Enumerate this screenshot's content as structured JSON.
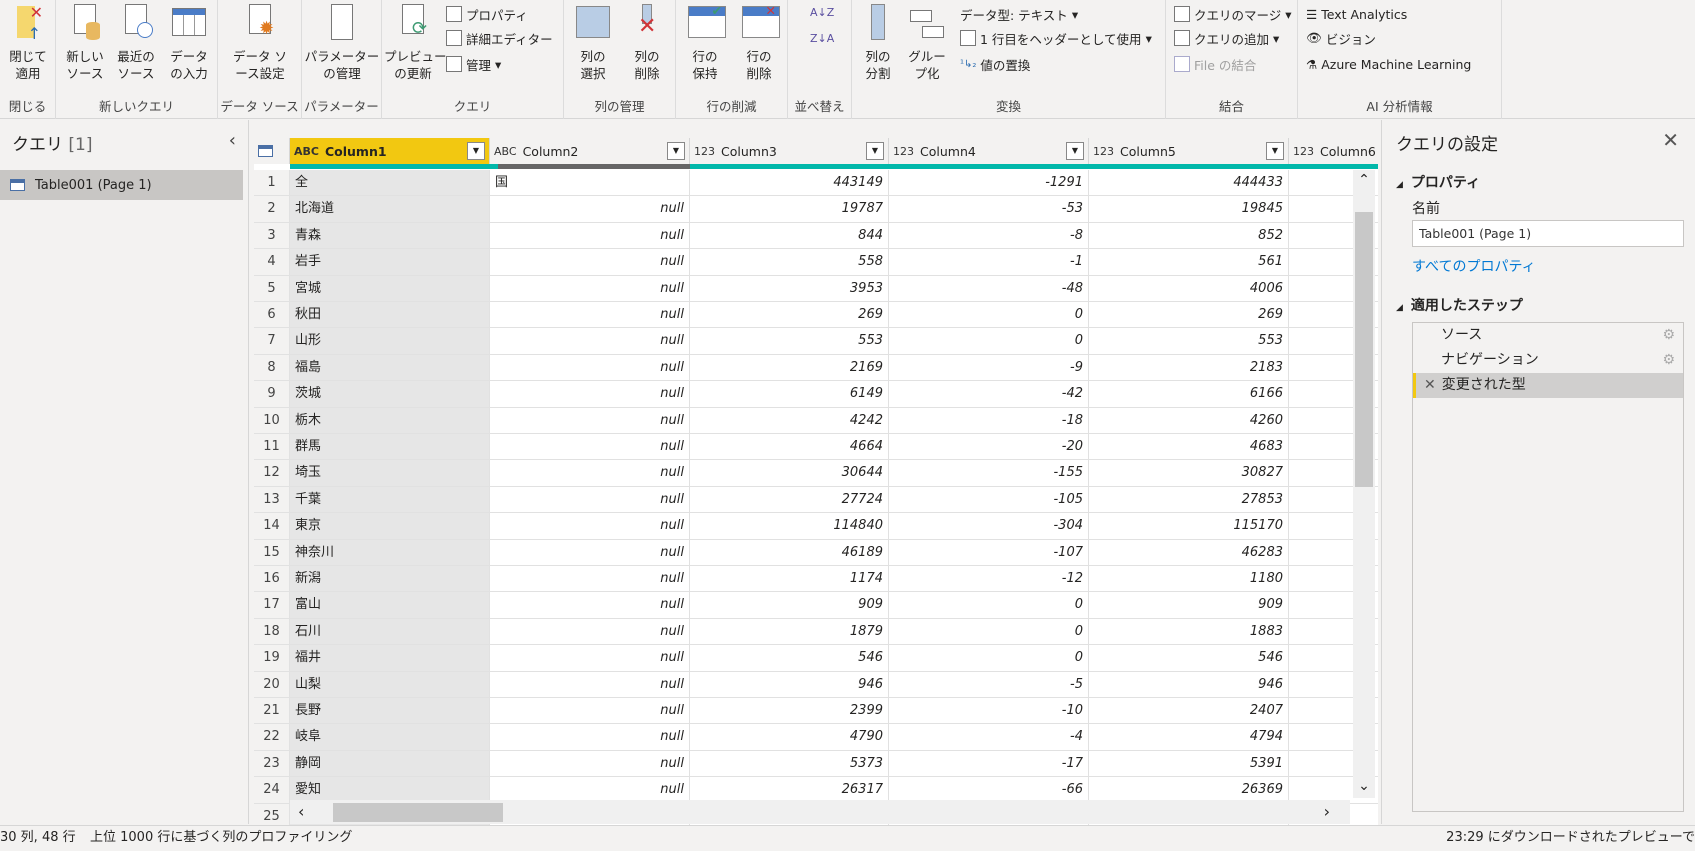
{
  "ribbon": {
    "close": {
      "btn": "閉じて\n適用",
      "label": "閉じる"
    },
    "newquery": {
      "new_source": "新しい\nソース",
      "recent": "最近の\nソース",
      "enter": "データ\nの入力",
      "label": "新しいクエリ"
    },
    "datasource": {
      "settings": "データ ソ\nース設定",
      "label": "データ ソース"
    },
    "params": {
      "manage": "パラメーター\nの管理",
      "label": "パラメーター"
    },
    "query": {
      "refresh": "プレビュー\nの更新",
      "properties": "プロパティ",
      "advanced": "詳細エディター",
      "manage": "管理",
      "label": "クエリ"
    },
    "columns": {
      "choose": "列の\n選択",
      "remove": "列の\n削除",
      "label": "列の管理"
    },
    "rows": {
      "keep": "行の\n保持",
      "remove": "行の\n削除",
      "label": "行の削減"
    },
    "sort": {
      "asc": "A↓Z",
      "desc": "Z↓A",
      "label": "並べ替え"
    },
    "transform": {
      "split": "列の\n分割",
      "group": "グルー\nプ化",
      "datatype": "データ型: テキスト",
      "header": "1 行目をヘッダーとして使用",
      "replace": "値の置換",
      "label": "変換"
    },
    "combine": {
      "merge": "クエリのマージ",
      "append": "クエリの追加",
      "files": "File の結合",
      "label": "結合"
    },
    "ai": {
      "text": "Text Analytics",
      "vision": "ビジョン",
      "azure": "Azure Machine Learning",
      "label": "AI 分析情報"
    }
  },
  "queries": {
    "title": "クエリ",
    "count": "[1]",
    "items": [
      "Table001 (Page 1)"
    ]
  },
  "grid": {
    "columns": [
      {
        "name": "Column1",
        "type": "ABC"
      },
      {
        "name": "Column2",
        "type": "ABC"
      },
      {
        "name": "Column3",
        "type": "123"
      },
      {
        "name": "Column4",
        "type": "123"
      },
      {
        "name": "Column5",
        "type": "123"
      },
      {
        "name": "Column6",
        "type": "123"
      }
    ],
    "rows": [
      [
        "全",
        "国",
        "443149",
        "-1291",
        "444433"
      ],
      [
        "北海道",
        "null",
        "19787",
        "-53",
        "19845"
      ],
      [
        "青森",
        "null",
        "844",
        "-8",
        "852"
      ],
      [
        "岩手",
        "null",
        "558",
        "-1",
        "561"
      ],
      [
        "宮城",
        "null",
        "3953",
        "-48",
        "4006"
      ],
      [
        "秋田",
        "null",
        "269",
        "0",
        "269"
      ],
      [
        "山形",
        "null",
        "553",
        "0",
        "553"
      ],
      [
        "福島",
        "null",
        "2169",
        "-9",
        "2183"
      ],
      [
        "茨城",
        "null",
        "6149",
        "-42",
        "6166"
      ],
      [
        "栃木",
        "null",
        "4242",
        "-18",
        "4260"
      ],
      [
        "群馬",
        "null",
        "4664",
        "-20",
        "4683"
      ],
      [
        "埼玉",
        "null",
        "30644",
        "-155",
        "30827"
      ],
      [
        "千葉",
        "null",
        "27724",
        "-105",
        "27853"
      ],
      [
        "東京",
        "null",
        "114840",
        "-304",
        "115170"
      ],
      [
        "神奈川",
        "null",
        "46189",
        "-107",
        "46283"
      ],
      [
        "新潟",
        "null",
        "1174",
        "-12",
        "1180"
      ],
      [
        "富山",
        "null",
        "909",
        "0",
        "909"
      ],
      [
        "石川",
        "null",
        "1879",
        "0",
        "1883"
      ],
      [
        "福井",
        "null",
        "546",
        "0",
        "546"
      ],
      [
        "山梨",
        "null",
        "946",
        "-5",
        "946"
      ],
      [
        "長野",
        "null",
        "2399",
        "-10",
        "2407"
      ],
      [
        "岐阜",
        "null",
        "4790",
        "-4",
        "4794"
      ],
      [
        "静岡",
        "null",
        "5373",
        "-17",
        "5391"
      ],
      [
        "愛知",
        "null",
        "26317",
        "-66",
        "26369"
      ]
    ],
    "last_row_number": "25"
  },
  "settings": {
    "title": "クエリの設定",
    "properties": "プロパティ",
    "name_label": "名前",
    "name_value": "Table001 (Page 1)",
    "all_properties": "すべてのプロパティ",
    "steps_title": "適用したステップ",
    "steps": [
      "ソース",
      "ナビゲーション",
      "変更された型"
    ]
  },
  "status": {
    "left": "30 列, 48 行",
    "profiling": "上位 1000 行に基づく列のプロファイリング",
    "right": "23:29 にダウンロードされたプレビューで"
  },
  "colors": {
    "accent": "#f2c811",
    "quality": "#01b8aa",
    "link": "#0078d4"
  }
}
